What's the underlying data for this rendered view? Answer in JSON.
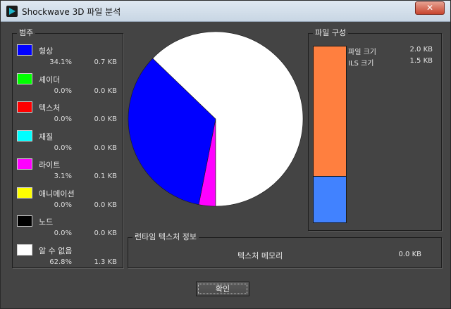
{
  "window": {
    "title": "Shockwave 3D 파일 분석",
    "close_glyph": "✕"
  },
  "legend": {
    "label": "범주",
    "items": [
      {
        "name": "형상",
        "percent": "34.1%",
        "size": "0.7 KB",
        "color": "#0000ff",
        "fraction": 0.341
      },
      {
        "name": "셰이더",
        "percent": "0.0%",
        "size": "0.0 KB",
        "color": "#00ff00",
        "fraction": 0.0
      },
      {
        "name": "텍스처",
        "percent": "0.0%",
        "size": "0.0 KB",
        "color": "#ff0000",
        "fraction": 0.0
      },
      {
        "name": "재질",
        "percent": "0.0%",
        "size": "0.0 KB",
        "color": "#00ffff",
        "fraction": 0.0
      },
      {
        "name": "라이트",
        "percent": "3.1%",
        "size": "0.1 KB",
        "color": "#ff00ff",
        "fraction": 0.031
      },
      {
        "name": "애니메이션",
        "percent": "0.0%",
        "size": "0.0 KB",
        "color": "#ffff00",
        "fraction": 0.0
      },
      {
        "name": "노드",
        "percent": "0.0%",
        "size": "0.0 KB",
        "color": "#000000",
        "fraction": 0.0
      },
      {
        "name": "알 수 없음",
        "percent": "62.8%",
        "size": "1.3 KB",
        "color": "#ffffff",
        "fraction": 0.628
      }
    ]
  },
  "file_composition": {
    "label": "파일 구성",
    "rows": [
      {
        "name": "파일 크기",
        "value": "2.0 KB",
        "color": "#ff7f3f"
      },
      {
        "name": "ILS 크기",
        "value": "1.5 KB",
        "color": "#4182ff"
      }
    ],
    "ils_fraction": 0.26
  },
  "runtime": {
    "label": "런타임 텍스처 정보",
    "texture_memory_label": "텍스처 메모리",
    "texture_memory_value": "0.0 KB"
  },
  "ok_button": "확인"
}
